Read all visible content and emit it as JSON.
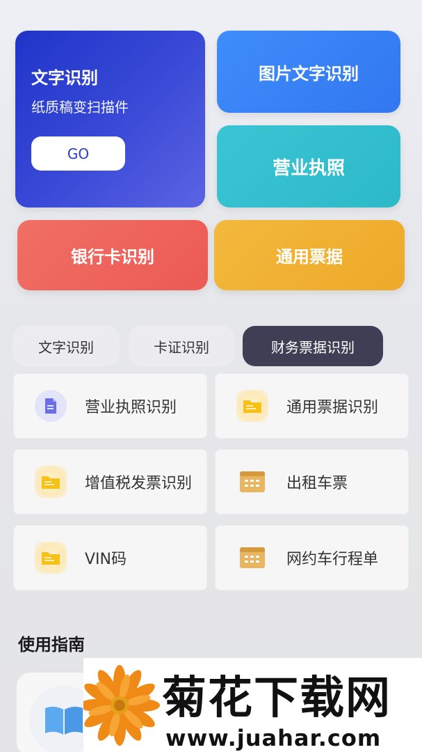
{
  "hero": {
    "title": "文字识别",
    "subtitle": "纸质稿变扫描件",
    "button": "GO"
  },
  "cards": {
    "image_text": "图片文字识别",
    "license": "营业执照",
    "bankcard": "银行卡识别",
    "ticket": "通用票据"
  },
  "tabs": [
    "文字识别",
    "卡证识别",
    "财务票据识别"
  ],
  "active_tab": "财务票据识别",
  "items": [
    {
      "label": "营业执照识别",
      "icon": "document-icon"
    },
    {
      "label": "通用票据识别",
      "icon": "folder-icon"
    },
    {
      "label": "增值税发票识别",
      "icon": "folder-icon"
    },
    {
      "label": "出租车票",
      "icon": "ticket-grid-icon"
    },
    {
      "label": "VIN码",
      "icon": "folder-icon"
    },
    {
      "label": "网约车行程单",
      "icon": "ticket-grid-icon"
    }
  ],
  "guide": {
    "title": "使用指南",
    "icon": "book-icon"
  },
  "watermark": {
    "brand": "菊花下载网",
    "url": "www.juahar.com"
  },
  "colors": {
    "hero": "#2f40cf",
    "image_text": "#3a86f8",
    "license": "#33c0cf",
    "bankcard": "#ee635c",
    "ticket": "#f1b233",
    "active_tab": "#3f3e55"
  }
}
